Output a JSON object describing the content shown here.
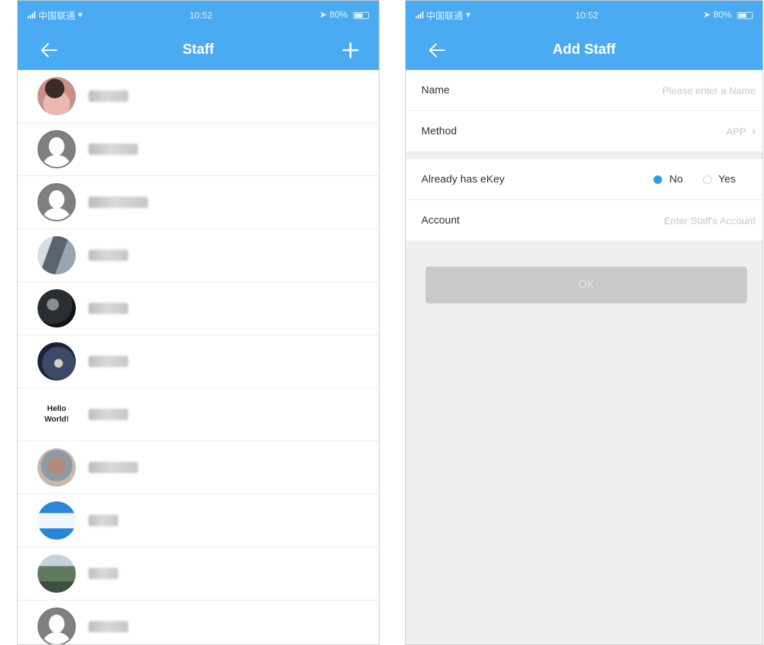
{
  "status_bar": {
    "carrier": "中国联通",
    "time": "10:52",
    "battery": "80%"
  },
  "staff_screen": {
    "title": "Staff",
    "back_icon": "arrow-left-icon",
    "add_icon": "plus-icon",
    "staff": [
      {
        "avatar": "photo-pink",
        "name": "████"
      },
      {
        "avatar": "default",
        "name": "Ada██"
      },
      {
        "avatar": "default",
        "name": "████Wu"
      },
      {
        "avatar": "photo-blue",
        "name": "████"
      },
      {
        "avatar": "photo-dark",
        "name": "████"
      },
      {
        "avatar": "photo-night",
        "name": "████"
      },
      {
        "avatar": "hello-world",
        "avatar_text": "Hello World!",
        "name": "████"
      },
      {
        "avatar": "photo-tree",
        "name": "████y"
      },
      {
        "avatar": "photo-app",
        "name": "███"
      },
      {
        "avatar": "photo-mountain",
        "name": "███"
      },
      {
        "avatar": "default",
        "name": "████"
      }
    ]
  },
  "add_staff_screen": {
    "title": "Add Staff",
    "back_icon": "arrow-left-icon",
    "name_label": "Name",
    "name_placeholder": "Please enter a Name",
    "method_label": "Method",
    "method_value": "APP",
    "ekey_label": "Already has eKey",
    "ekey_options": [
      {
        "label": "No",
        "selected": true
      },
      {
        "label": "Yes",
        "selected": false
      }
    ],
    "account_label": "Account",
    "account_placeholder": "Enter Staff's Account",
    "ok_label": "OK"
  },
  "colors": {
    "header": "#4aaaf2",
    "radio_selected": "#2d9be8",
    "ok_button_disabled": "#c9c9c9",
    "background": "#efefef"
  }
}
